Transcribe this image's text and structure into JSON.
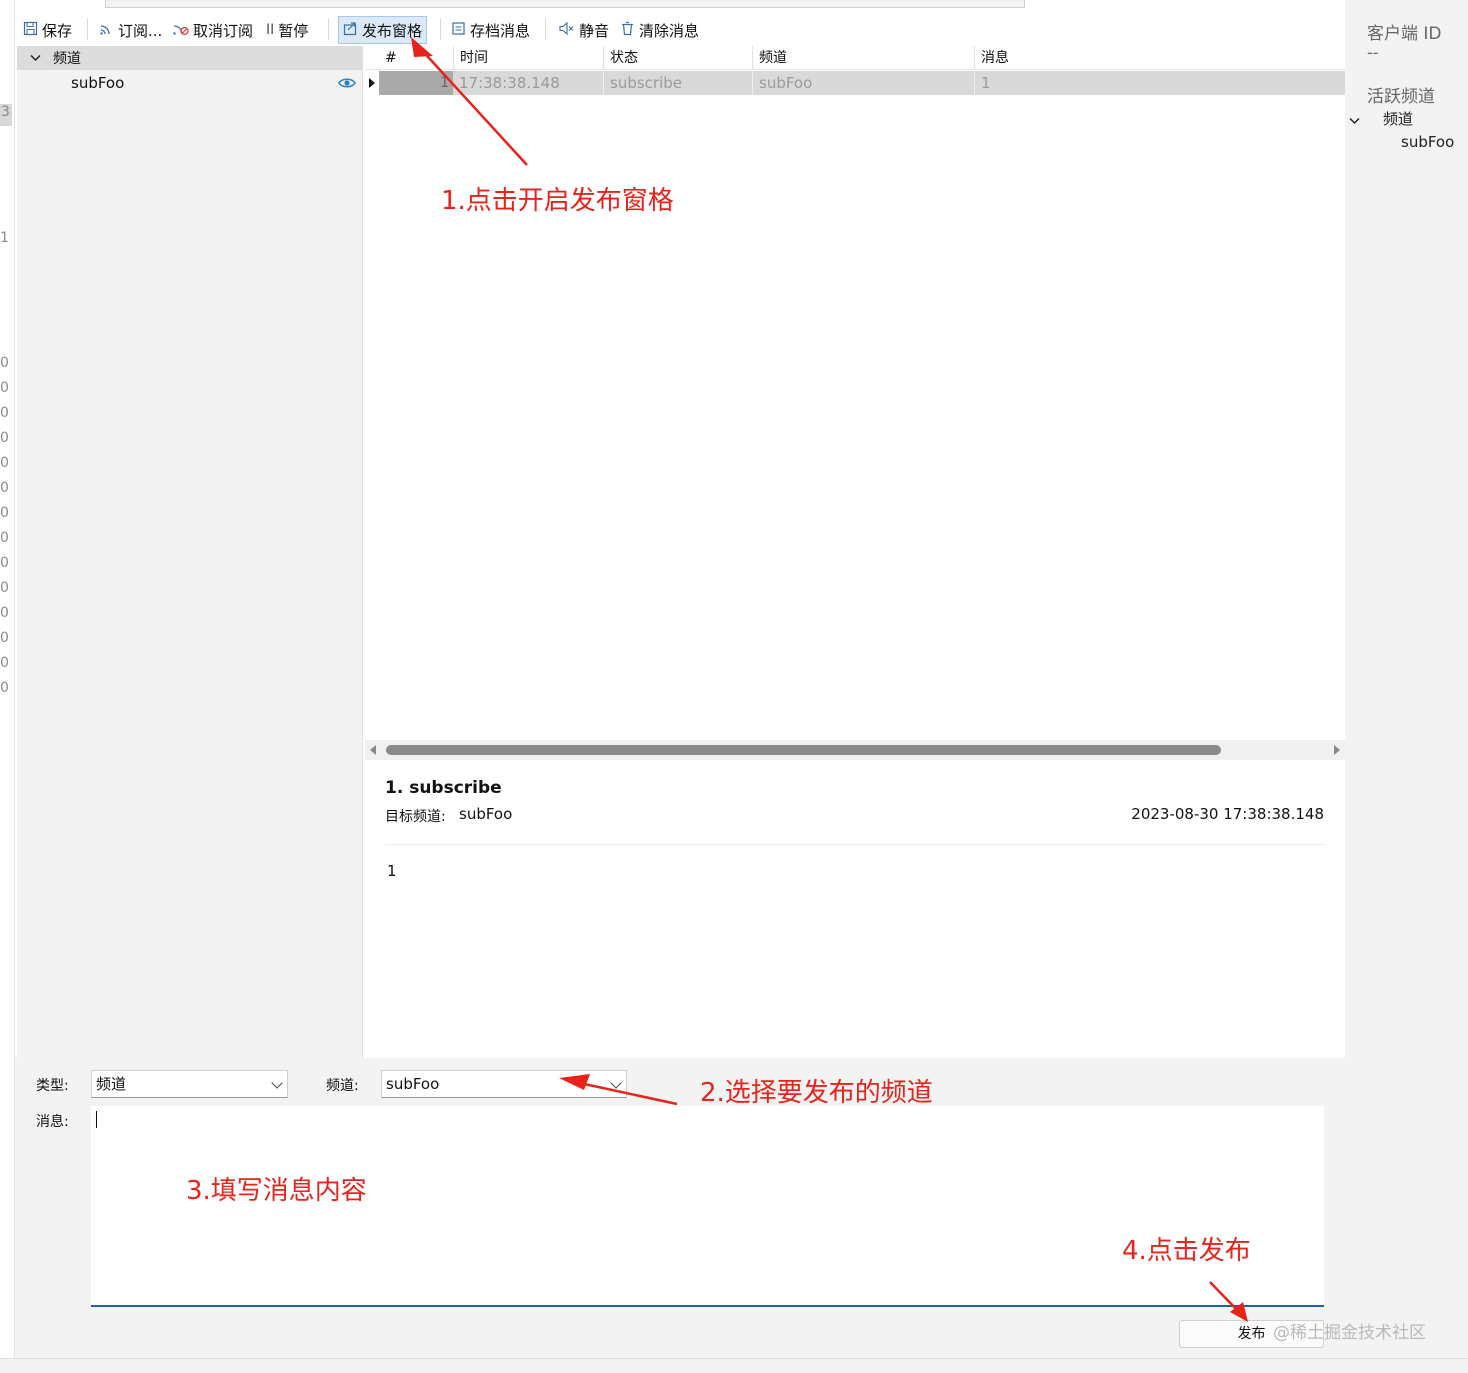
{
  "toolbar": {
    "save": "保存",
    "subscribe": "订阅...",
    "unsubscribe": "取消订阅",
    "pause": "暂停",
    "publish_pane": "发布窗格",
    "archive": "存档消息",
    "mute": "静音",
    "clear": "清除消息"
  },
  "gutter": {
    "numbers": [
      "3",
      "1",
      "0",
      "0",
      "0",
      "0",
      "0",
      "0",
      "0",
      "0",
      "0",
      "0",
      "0",
      "0",
      "0",
      "0"
    ]
  },
  "tree": {
    "header": "频道",
    "items": [
      "subFoo"
    ]
  },
  "grid": {
    "columns": [
      "#",
      "时间",
      "状态",
      "频道",
      "消息"
    ],
    "rows": [
      {
        "num": "1",
        "time": "17:38:38.148",
        "status": "subscribe",
        "channel": "subFoo",
        "message": "1"
      }
    ]
  },
  "detail": {
    "title": "1.  subscribe",
    "channel_label": "目标频道:",
    "channel": "subFoo",
    "timestamp": "2023-08-30 17:38:38.148",
    "body": "1"
  },
  "publish": {
    "type_label": "类型:",
    "type_value": "频道",
    "channel_label": "频道:",
    "channel_value": "subFoo",
    "message_label": "消息:",
    "message_value": "",
    "button": "发布"
  },
  "right_panel": {
    "client_id_label": "客户端 ID",
    "client_id_value": "--",
    "active_channels_label": "活跃频道",
    "tree_header": "频道",
    "tree_item": "subFoo"
  },
  "annotations": {
    "a1": "1.点击开启发布窗格",
    "a2": "2.选择要发布的频道",
    "a3": "3.填写消息内容",
    "a4": "4.点击发布"
  },
  "watermark": "@稀土掘金技术社区",
  "colors": {
    "annotation": "#e8231b",
    "accent": "#1f5fa8",
    "selected_toolbar_bg": "#dbe9f8"
  }
}
